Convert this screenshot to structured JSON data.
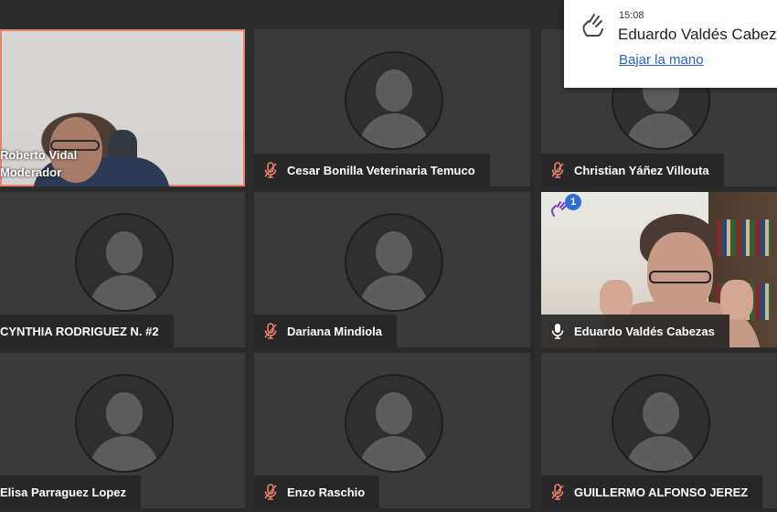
{
  "colors": {
    "active_speaker_border": "#e9806b",
    "muted_mic": "#e9806b",
    "link": "#2a64c3",
    "badge": "#2f6fd1"
  },
  "participants": [
    {
      "name": "Roberto Vidal",
      "role": "Moderador",
      "video": true,
      "speaking": true
    },
    {
      "name": "Cesar Bonilla Veterinaria Temuco",
      "muted": true
    },
    {
      "name": "Christian Yáñez Villouta",
      "muted": true
    },
    {
      "name": "CYNTHIA RODRIGUEZ N. #2",
      "muted": false
    },
    {
      "name": "Dariana Mindiola",
      "muted": true
    },
    {
      "name": "Eduardo Valdés Cabezas",
      "video": true,
      "muted": false,
      "hand_raised": true,
      "hand_count": "1"
    },
    {
      "name": "Elisa Parraguez Lopez",
      "muted": false
    },
    {
      "name": "Enzo Raschio",
      "muted": true
    },
    {
      "name": "GUILLERMO ALFONSO JEREZ",
      "muted": true
    }
  ],
  "notification": {
    "time": "15:08",
    "name": "Eduardo Valdés Cabezas",
    "action_label": "Bajar la mano",
    "icon": "raised-hand-icon"
  }
}
